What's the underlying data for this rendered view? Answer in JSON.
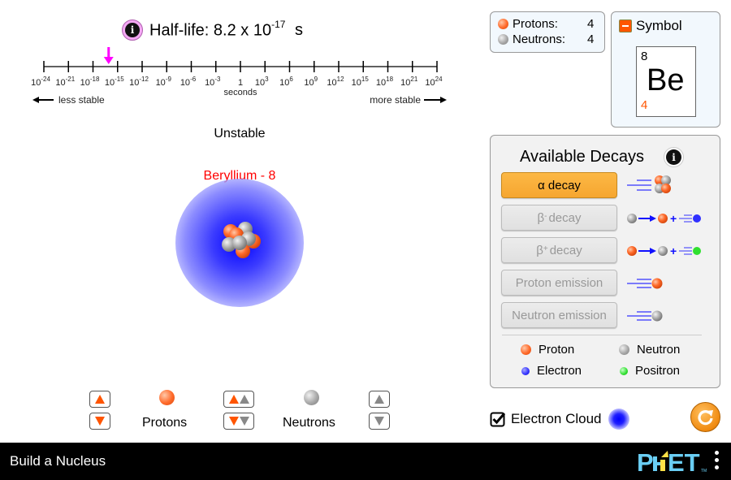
{
  "half_life": {
    "label": "Half-life: 8.2 x 10",
    "exponent": "-17",
    "unit": "s",
    "value_seconds": 8.2e-17
  },
  "scale": {
    "ticks": [
      "-24",
      "-21",
      "-18",
      "-15",
      "-12",
      "-9",
      "-6",
      "-3",
      "0",
      "3",
      "6",
      "9",
      "12",
      "15",
      "18",
      "21",
      "24"
    ],
    "axis_label": "seconds",
    "left_label": "less stable",
    "right_label": "more stable",
    "marker_exponent": -16.09,
    "marker_color": "#ff00ff"
  },
  "stability": "Unstable",
  "element_name": "Beryllium - 8",
  "element_name_color": "#ff0000",
  "counts": {
    "protons_label": "Protons:",
    "protons_value": "4",
    "neutrons_label": "Neutrons:",
    "neutrons_value": "4"
  },
  "symbol": {
    "title": "Symbol",
    "mass_number": "8",
    "letters": "Be",
    "atomic_number": "4",
    "expanded": true
  },
  "decays": {
    "title": "Available Decays",
    "buttons": [
      {
        "label": "α decay",
        "sup": "",
        "enabled": true
      },
      {
        "label": "β",
        "sup": "-",
        "suffix": " decay",
        "enabled": false
      },
      {
        "label": "β",
        "sup": "+",
        "suffix": " decay",
        "enabled": false
      },
      {
        "label": "Proton emission",
        "sup": "",
        "enabled": false
      },
      {
        "label": "Neutron emission",
        "sup": "",
        "enabled": false
      }
    ],
    "legend": {
      "proton": "Proton",
      "neutron": "Neutron",
      "electron": "Electron",
      "positron": "Positron"
    }
  },
  "controls": {
    "protons_label": "Protons",
    "neutrons_label": "Neutrons"
  },
  "electron_cloud": {
    "label": "Electron Cloud",
    "checked": true
  },
  "navbar": {
    "title": "Build a Nucleus",
    "logo": "PhET"
  },
  "colors": {
    "proton": "#ff6a2a",
    "neutron": "#a8a8a8",
    "electron": "#3030ff",
    "positron": "#30e030",
    "active_button": "#f6a630",
    "reset": "#f08a10"
  }
}
